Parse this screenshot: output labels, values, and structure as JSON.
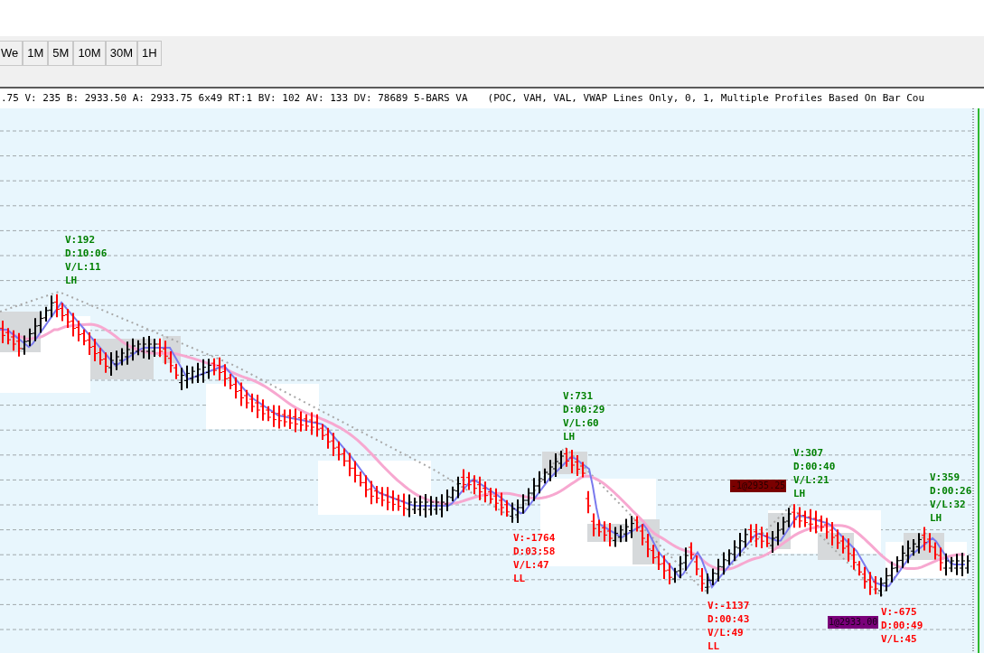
{
  "toolbar": {
    "buttons": [
      {
        "label": "We"
      },
      {
        "label": "1M"
      },
      {
        "label": "5M"
      },
      {
        "label": "10M"
      },
      {
        "label": "30M"
      },
      {
        "label": "1H"
      }
    ]
  },
  "info_line": ".75 V: 235 B: 2933.50 A: 2933.75 6x49 RT:1 BV: 102 AV: 133 DV: 78689 5-BARS VA",
  "study_label": "(POC, VAH, VAL, VWAP Lines Only, 0, 1, Multiple Profiles Based On Bar Cou",
  "swing_labels": [
    {
      "kind": "high",
      "lines": [
        "V:192",
        "D:10:06",
        "V/L:11",
        "LH"
      ]
    },
    {
      "kind": "high",
      "lines": [
        "V:731",
        "D:00:29",
        "V/L:60",
        "LH"
      ]
    },
    {
      "kind": "high",
      "lines": [
        "V:307",
        "D:00:40",
        "V/L:21",
        "LH"
      ]
    },
    {
      "kind": "high",
      "lines": [
        "V:359",
        "D:00:26",
        "V/L:32",
        "LH"
      ]
    },
    {
      "kind": "low",
      "lines": [
        "V:-1764",
        "D:03:58",
        "V/L:47",
        "LL"
      ]
    },
    {
      "kind": "low",
      "lines": [
        "V:-1137",
        "D:00:43",
        "V/L:49",
        "LL"
      ]
    },
    {
      "kind": "low",
      "lines": [
        "V:-675",
        "D:00:49",
        "V/L:45"
      ]
    }
  ],
  "order_tags": [
    {
      "kind": "sell",
      "text": "-1@2935.25"
    },
    {
      "kind": "buy",
      "text": "1@2933.00"
    }
  ]
}
